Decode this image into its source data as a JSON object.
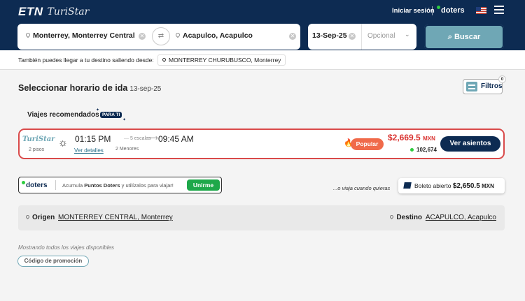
{
  "header": {
    "logo_main": "ETN",
    "logo_script": "TuriStar",
    "login_label": "Iniciar sesión",
    "doters_label": "doters",
    "flag_icon": "us-flag-icon",
    "menu_icon": "hamburger-menu-icon"
  },
  "search": {
    "origin": "Monterrey, Monterrey Central",
    "destination": "Acapulco, Acapulco",
    "date": "13-Sep-25",
    "return_placeholder": "Opcional",
    "button_label": "Buscar"
  },
  "alternative": {
    "label": "También puedes llegar a tu destino saliendo desde:",
    "station": "MONTERREY CHURUBUSCO, Monterrey"
  },
  "main": {
    "heading": "Seleccionar horario de ida",
    "heading_date": "13-sep-25",
    "filters_label": "Filtros",
    "filters_count": "0",
    "recommended_label": "Viajes recomendados",
    "para_ti_badge": "PARA TI"
  },
  "trip": {
    "brand": "TuriStar",
    "floors": "2 pisos",
    "departure": "01:15 PM",
    "stops": "5 escalas",
    "arrival": "09:45 AM",
    "details_link": "Ver detalles",
    "minors": "2 Menores",
    "badge": "Popular",
    "price": "$2,669.5",
    "currency": "MXN",
    "points": "102,674",
    "seats_button": "Ver asientos"
  },
  "doters_card": {
    "logo": "doters",
    "text_prefix": "Acumula",
    "text_bold": "Puntos Doters",
    "text_suffix": "y utilízalos para viajar!",
    "button": "Unirme"
  },
  "open_ticket": {
    "lead": "...o viaja cuando quieras",
    "label": "Boleto abierto",
    "price": "$2,650.5",
    "currency": "MXN"
  },
  "route_bar": {
    "origin_label": "Origen",
    "origin_value": "MONTERREY CENTRAL, Monterrey",
    "dest_label": "Destino",
    "dest_value": "ACAPULCO, Acapulco"
  },
  "footer": {
    "showing_all": "Mostrando todos los viajes disponibles",
    "promo_button": "Código de promoción"
  },
  "colors": {
    "navy": "#0d2b52",
    "accent_teal": "#6fa7b5",
    "price_red": "#d9322f",
    "doters_green": "#1ea84a"
  }
}
